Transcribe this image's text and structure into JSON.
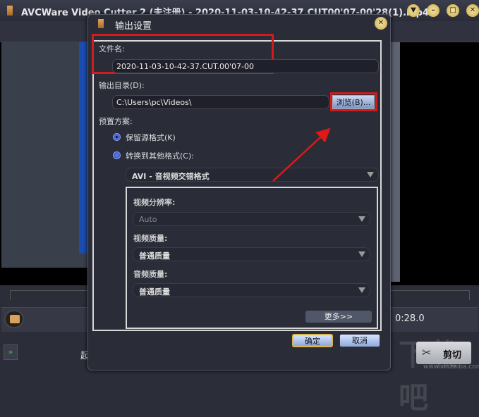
{
  "app": {
    "title": "AVCWare Video Cutter 2 (未注册) - 2020-11-03-10-42-37.CUT00'07-00'28(1).mp4",
    "time": "0:28.0",
    "start_label": "起",
    "cut_label": "剪切",
    "window_buttons": [
      "menu-icon",
      "minimize-icon",
      "maximize-icon",
      "close-icon"
    ]
  },
  "watermark": {
    "text": "下载吧",
    "url": "www.xiazaiba.com"
  },
  "dialog": {
    "title": "输出设置",
    "filename_label": "文件名:",
    "filename_value": "2020-11-03-10-42-37.CUT.00'07-00",
    "output_dir_label": "输出目录(D):",
    "output_dir_value": "C:\\Users\\pc\\Videos\\",
    "browse_label": "浏览(B)...",
    "preset_label": "预置方案:",
    "radio_keep": "保留源格式(K)",
    "radio_convert": "转换到其他格式(C):",
    "format_value": "AVI - 音视频交错格式",
    "resolution_label": "视频分辨率:",
    "resolution_value": "Auto",
    "video_quality_label": "视频质量:",
    "video_quality_value": "普通质量",
    "audio_quality_label": "音频质量:",
    "audio_quality_value": "普通质量",
    "more_label": "更多>>",
    "ok_label": "确定",
    "cancel_label": "取消",
    "selected_preset": "keep",
    "highlight_color": "#d21c1c"
  }
}
